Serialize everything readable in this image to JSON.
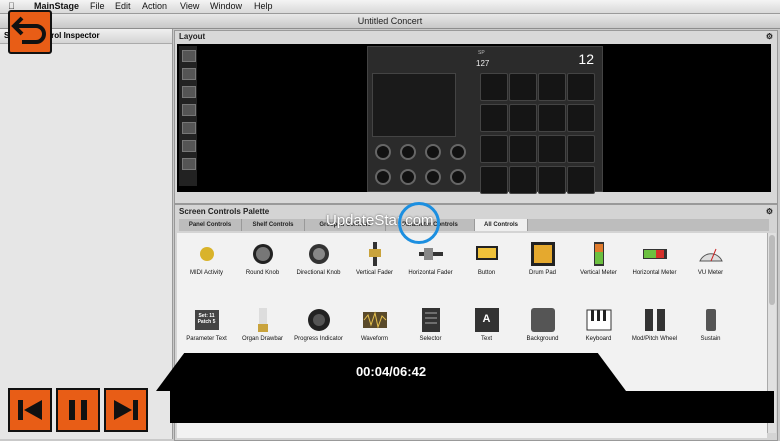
{
  "menubar": {
    "app": "MainStage",
    "items": [
      "File",
      "Edit",
      "Action",
      "View",
      "Window",
      "Help"
    ]
  },
  "window_title": "Untitled Concert",
  "inspector": {
    "title": "Screen Control Inspector"
  },
  "layout": {
    "title": "Layout",
    "synth": {
      "label": "SP",
      "value": "127",
      "number": "12"
    }
  },
  "palette": {
    "title": "Screen Controls Palette",
    "tabs": [
      "Panel Controls",
      "Shelf Controls",
      "Grouped Controls",
      "Parameter Controls",
      "All Controls"
    ],
    "active_tab": "All Controls",
    "row1": [
      {
        "label": "MIDI Activity",
        "icon": "midi-activity-icon"
      },
      {
        "label": "Round Knob",
        "icon": "round-knob-icon"
      },
      {
        "label": "Directional Knob",
        "icon": "directional-knob-icon"
      },
      {
        "label": "Vertical Fader",
        "icon": "vertical-fader-icon"
      },
      {
        "label": "Horizontal Fader",
        "icon": "horizontal-fader-icon"
      },
      {
        "label": "Button",
        "icon": "button-icon"
      },
      {
        "label": "Drum Pad",
        "icon": "drum-pad-icon"
      },
      {
        "label": "Vertical Meter",
        "icon": "vertical-meter-icon"
      },
      {
        "label": "Horizontal Meter",
        "icon": "horizontal-meter-icon"
      },
      {
        "label": "VU Meter",
        "icon": "vu-meter-icon"
      }
    ],
    "row2": [
      {
        "label": "Parameter Text",
        "icon": "parameter-text-icon",
        "text": "Set: 11 Patch 5"
      },
      {
        "label": "Organ Drawbar",
        "icon": "organ-drawbar-icon"
      },
      {
        "label": "Progress Indicator",
        "icon": "progress-indicator-icon"
      },
      {
        "label": "Waveform",
        "icon": "waveform-icon"
      },
      {
        "label": "Selector",
        "icon": "selector-icon"
      },
      {
        "label": "Text",
        "icon": "text-icon",
        "text": "A"
      },
      {
        "label": "Background",
        "icon": "background-icon"
      },
      {
        "label": "Keyboard",
        "icon": "keyboard-icon"
      },
      {
        "label": "Mod/Pitch Wheel",
        "icon": "mod-pitch-wheel-icon"
      },
      {
        "label": "Sustain",
        "icon": "sustain-icon"
      }
    ]
  },
  "watermark": "UpdateStar.com",
  "player": {
    "time": "00:04/06:42"
  }
}
